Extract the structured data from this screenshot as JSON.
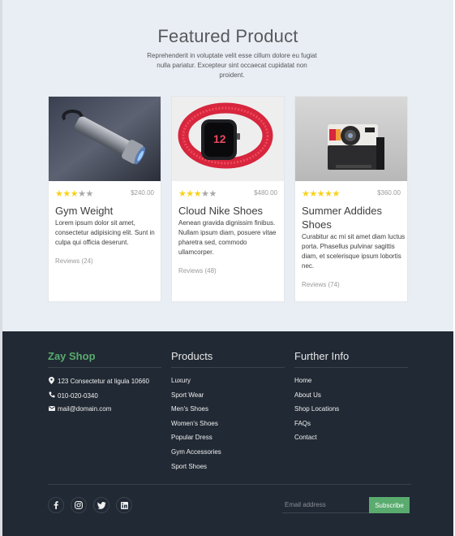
{
  "featured": {
    "title": "Featured Product",
    "subtitle": "Reprehenderit in voluptate velit esse cillum dolore eu fugiat nulla pariatur. Excepteur sint occaecat cupidatat non proident."
  },
  "products": [
    {
      "name": "Gym Weight",
      "price": "$240.00",
      "rating": 3,
      "description": "Lorem ipsum dolor sit amet, consectetur adipisicing elit. Sunt in culpa qui officia deserunt.",
      "reviews": "Reviews (24)",
      "image_icon": "flashlight-photo"
    },
    {
      "name": "Cloud Nike Shoes",
      "price": "$480.00",
      "rating": 3,
      "description": "Aenean gravida dignissim finibus. Nullam ipsum diam, posuere vitae pharetra sed, commodo ullamcorper.",
      "reviews": "Reviews (48)",
      "image_icon": "smartwatch-photo"
    },
    {
      "name": "Summer Addides Shoes",
      "price": "$360.00",
      "rating": 5,
      "description": "Curabitur ac mi sit amet diam luctus porta. Phasellus pulvinar sagittis diam, et scelerisque ipsum lobortis nec.",
      "reviews": "Reviews (74)",
      "image_icon": "instant-camera-photo"
    }
  ],
  "footer": {
    "brand": "Zay Shop",
    "contact": {
      "address": "123 Consectetur at ligula 10660",
      "phone": "010-020-0340",
      "email": "mail@domain.com"
    },
    "products_heading": "Products",
    "product_links": [
      "Luxury",
      "Sport Wear",
      "Men's Shoes",
      "Women's Shoes",
      "Popular Dress",
      "Gym Accessories",
      "Sport Shoes"
    ],
    "info_heading": "Further Info",
    "info_links": [
      "Home",
      "About Us",
      "Shop Locations",
      "FAQs",
      "Contact"
    ],
    "social_icons": [
      "facebook-icon",
      "instagram-icon",
      "twitter-icon",
      "linkedin-icon"
    ],
    "email_placeholder": "Email address",
    "subscribe_label": "Subscribe"
  },
  "colors": {
    "accent": "#59ab6e",
    "footer_bg": "#212934",
    "featured_bg": "#e9eef5",
    "star": "#f7d21a"
  }
}
